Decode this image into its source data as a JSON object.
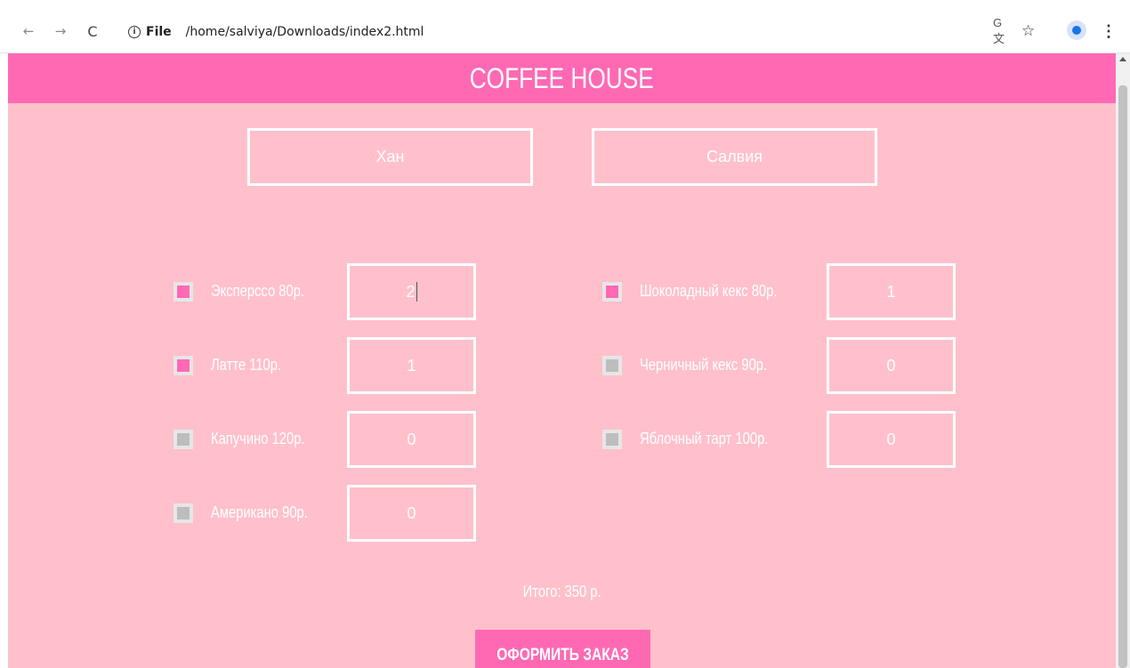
{
  "browser": {
    "scheme_label": "File",
    "url": "/home/salviya/Downloads/index2.html",
    "nav": {
      "back": "←",
      "forward": "→",
      "reload": "C"
    },
    "icons": {
      "info": "i",
      "translate": "G文",
      "star": "☆",
      "menu": "⋮"
    }
  },
  "page": {
    "title": "COFFEE HOUSE",
    "background_color": "#ffc0cb",
    "accent_color": "#ff69b4",
    "names": [
      "Хан",
      "Салвия"
    ],
    "items_left": [
      {
        "label": "Эксперссо 80р.",
        "checked": true,
        "quantity": "2"
      },
      {
        "label": "Латте 110р.",
        "checked": true,
        "quantity": "1"
      },
      {
        "label": "Капучино 120р.",
        "checked": false,
        "quantity": "0"
      },
      {
        "label": "Американо 90р.",
        "checked": false,
        "quantity": "0"
      }
    ],
    "items_right": [
      {
        "label": "Шоколадный кекс 80р.",
        "checked": true,
        "quantity": "1"
      },
      {
        "label": "Черничный кекс 90р.",
        "checked": false,
        "quantity": "0"
      },
      {
        "label": "Яблочный тарт 100р.",
        "checked": false,
        "quantity": "0"
      }
    ],
    "total_text": "Итого: 350 р.",
    "order_button_label": "ОФОРМИТЬ ЗАКАЗ"
  }
}
